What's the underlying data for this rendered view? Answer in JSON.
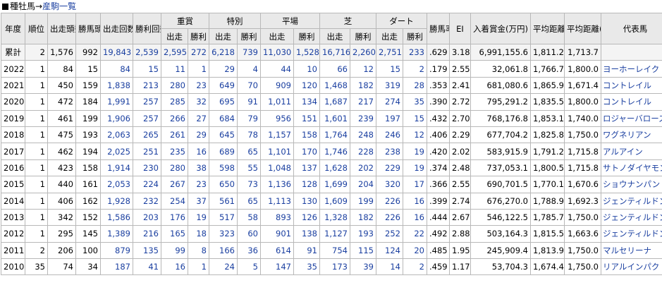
{
  "title": {
    "prefix": "種牡馬",
    "arrow": "→",
    "link": "産駒一覧"
  },
  "headers": {
    "year": "年度",
    "rank": "順位",
    "runners": "出走頭数",
    "winners": "勝馬頭数",
    "starts": "出走回数",
    "wins": "勝利回数",
    "graded": "重賞",
    "special": "特別",
    "flat": "平場",
    "turf": "芝",
    "dirt": "ダート",
    "win_rate": "勝馬率",
    "ei": "EI",
    "earnings": "入着賞金(万円)",
    "avg_turf": "平均距離(芝)",
    "avg_dirt": "平均距離(ダ)",
    "rep_horse": "代表馬",
    "sub_starts": "出走",
    "sub_wins": "勝利"
  },
  "rows": [
    {
      "year": "累計",
      "rank": "2",
      "runners": "1,576",
      "winners": "992",
      "starts": "19,843",
      "wins": "2,539",
      "g_s": "2,595",
      "g_w": "272",
      "sp_s": "6,218",
      "sp_w": "739",
      "fl_s": "11,030",
      "fl_w": "1,528",
      "t_s": "16,716",
      "t_w": "2,260",
      "d_s": "2,751",
      "d_w": "233",
      "rate": ".629",
      "ei": "3.18",
      "earn": "6,991,155.6",
      "avg_t": "1,811.2",
      "avg_d": "1,713.7",
      "horse": ""
    },
    {
      "year": "2022",
      "rank": "1",
      "runners": "84",
      "winners": "15",
      "starts": "84",
      "wins": "15",
      "g_s": "11",
      "g_w": "1",
      "sp_s": "29",
      "sp_w": "4",
      "fl_s": "44",
      "fl_w": "10",
      "t_s": "66",
      "t_w": "12",
      "d_s": "15",
      "d_w": "2",
      "rate": ".179",
      "ei": "2.55",
      "earn": "32,061.8",
      "avg_t": "1,766.7",
      "avg_d": "1,800.0",
      "horse": "ヨーホーレイク"
    },
    {
      "year": "2021",
      "rank": "1",
      "runners": "450",
      "winners": "159",
      "starts": "1,838",
      "wins": "213",
      "g_s": "280",
      "g_w": "23",
      "sp_s": "649",
      "sp_w": "70",
      "fl_s": "909",
      "fl_w": "120",
      "t_s": "1,468",
      "t_w": "182",
      "d_s": "319",
      "d_w": "28",
      "rate": ".353",
      "ei": "2.41",
      "earn": "681,080.6",
      "avg_t": "1,865.9",
      "avg_d": "1,671.4",
      "horse": "コントレイル"
    },
    {
      "year": "2020",
      "rank": "1",
      "runners": "472",
      "winners": "184",
      "starts": "1,991",
      "wins": "257",
      "g_s": "285",
      "g_w": "32",
      "sp_s": "695",
      "sp_w": "91",
      "fl_s": "1,011",
      "fl_w": "134",
      "t_s": "1,687",
      "t_w": "217",
      "d_s": "274",
      "d_w": "35",
      "rate": ".390",
      "ei": "2.72",
      "earn": "795,291.2",
      "avg_t": "1,835.5",
      "avg_d": "1,800.0",
      "horse": "コントレイル"
    },
    {
      "year": "2019",
      "rank": "1",
      "runners": "461",
      "winners": "199",
      "starts": "1,906",
      "wins": "257",
      "g_s": "266",
      "g_w": "27",
      "sp_s": "684",
      "sp_w": "79",
      "fl_s": "956",
      "fl_w": "151",
      "t_s": "1,601",
      "t_w": "239",
      "d_s": "197",
      "d_w": "15",
      "rate": ".432",
      "ei": "2.70",
      "earn": "768,176.8",
      "avg_t": "1,853.1",
      "avg_d": "1,740.0",
      "horse": "ロジャーバローズ"
    },
    {
      "year": "2018",
      "rank": "1",
      "runners": "475",
      "winners": "193",
      "starts": "2,063",
      "wins": "265",
      "g_s": "261",
      "g_w": "29",
      "sp_s": "645",
      "sp_w": "78",
      "fl_s": "1,157",
      "fl_w": "158",
      "t_s": "1,764",
      "t_w": "248",
      "d_s": "246",
      "d_w": "12",
      "rate": ".406",
      "ei": "2.29",
      "earn": "677,704.2",
      "avg_t": "1,825.8",
      "avg_d": "1,750.0",
      "horse": "ワグネリアン"
    },
    {
      "year": "2017",
      "rank": "1",
      "runners": "462",
      "winners": "194",
      "starts": "2,025",
      "wins": "251",
      "g_s": "235",
      "g_w": "16",
      "sp_s": "689",
      "sp_w": "65",
      "fl_s": "1,101",
      "fl_w": "170",
      "t_s": "1,746",
      "t_w": "228",
      "d_s": "238",
      "d_w": "19",
      "rate": ".420",
      "ei": "2.02",
      "earn": "583,915.9",
      "avg_t": "1,791.2",
      "avg_d": "1,715.8",
      "horse": "アルアイン"
    },
    {
      "year": "2016",
      "rank": "1",
      "runners": "423",
      "winners": "158",
      "starts": "1,914",
      "wins": "230",
      "g_s": "280",
      "g_w": "38",
      "sp_s": "598",
      "sp_w": "55",
      "fl_s": "1,048",
      "fl_w": "137",
      "t_s": "1,628",
      "t_w": "202",
      "d_s": "229",
      "d_w": "19",
      "rate": ".374",
      "ei": "2.48",
      "earn": "737,053.1",
      "avg_t": "1,800.5",
      "avg_d": "1,715.8",
      "horse": "サトノダイヤモンド"
    },
    {
      "year": "2015",
      "rank": "1",
      "runners": "440",
      "winners": "161",
      "starts": "2,053",
      "wins": "224",
      "g_s": "267",
      "g_w": "23",
      "sp_s": "650",
      "sp_w": "73",
      "fl_s": "1,136",
      "fl_w": "128",
      "t_s": "1,699",
      "t_w": "204",
      "d_s": "320",
      "d_w": "17",
      "rate": ".366",
      "ei": "2.55",
      "earn": "690,701.5",
      "avg_t": "1,770.1",
      "avg_d": "1,670.6",
      "horse": "ショウナンパンドラ"
    },
    {
      "year": "2014",
      "rank": "1",
      "runners": "406",
      "winners": "162",
      "starts": "1,928",
      "wins": "232",
      "g_s": "254",
      "g_w": "37",
      "sp_s": "561",
      "sp_w": "65",
      "fl_s": "1,113",
      "fl_w": "130",
      "t_s": "1,609",
      "t_w": "199",
      "d_s": "226",
      "d_w": "16",
      "rate": ".399",
      "ei": "2.74",
      "earn": "676,270.0",
      "avg_t": "1,788.9",
      "avg_d": "1,692.3",
      "horse": "ジェンティルドンナ"
    },
    {
      "year": "2013",
      "rank": "1",
      "runners": "342",
      "winners": "152",
      "starts": "1,586",
      "wins": "203",
      "g_s": "176",
      "g_w": "19",
      "sp_s": "517",
      "sp_w": "58",
      "fl_s": "893",
      "fl_w": "126",
      "t_s": "1,328",
      "t_w": "182",
      "d_s": "226",
      "d_w": "16",
      "rate": ".444",
      "ei": "2.67",
      "earn": "546,122.5",
      "avg_t": "1,785.7",
      "avg_d": "1,750.0",
      "horse": "ジェンティルドンナ"
    },
    {
      "year": "2012",
      "rank": "1",
      "runners": "295",
      "winners": "145",
      "starts": "1,389",
      "wins": "216",
      "g_s": "165",
      "g_w": "18",
      "sp_s": "323",
      "sp_w": "60",
      "fl_s": "901",
      "fl_w": "138",
      "t_s": "1,127",
      "t_w": "193",
      "d_s": "252",
      "d_w": "22",
      "rate": ".492",
      "ei": "2.88",
      "earn": "503,164.3",
      "avg_t": "1,815.5",
      "avg_d": "1,663.6",
      "horse": "ジェンティルドンナ"
    },
    {
      "year": "2011",
      "rank": "2",
      "runners": "206",
      "winners": "100",
      "starts": "879",
      "wins": "135",
      "g_s": "99",
      "g_w": "8",
      "sp_s": "166",
      "sp_w": "36",
      "fl_s": "614",
      "fl_w": "91",
      "t_s": "754",
      "t_w": "115",
      "d_s": "124",
      "d_w": "20",
      "rate": ".485",
      "ei": "1.95",
      "earn": "245,909.4",
      "avg_t": "1,813.9",
      "avg_d": "1,750.0",
      "horse": "マルセリーナ"
    },
    {
      "year": "2010",
      "rank": "35",
      "runners": "74",
      "winners": "34",
      "starts": "187",
      "wins": "41",
      "g_s": "16",
      "g_w": "1",
      "sp_s": "24",
      "sp_w": "5",
      "fl_s": "147",
      "fl_w": "35",
      "t_s": "173",
      "t_w": "39",
      "d_s": "14",
      "d_w": "2",
      "rate": ".459",
      "ei": "1.17",
      "earn": "53,704.3",
      "avg_t": "1,674.4",
      "avg_d": "1,750.0",
      "horse": "リアルインパクト"
    }
  ]
}
